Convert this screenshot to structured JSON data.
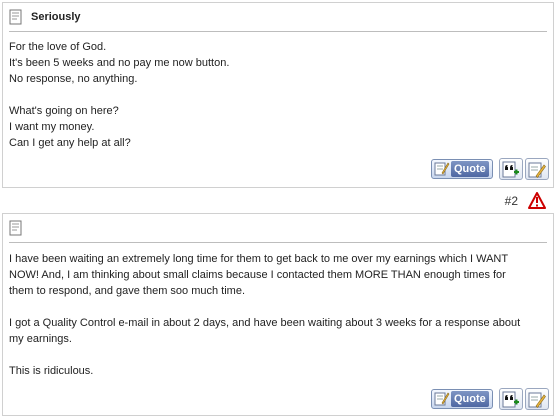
{
  "posts": [
    {
      "title": "Seriously",
      "paragraphs": [
        [
          "For the love of God.",
          "It's been 5 weeks and no pay me now button.",
          "No response, no anything."
        ],
        [
          "What's going on here?",
          "I want my money.",
          "Can I get any help at all?"
        ]
      ],
      "actions": {
        "quote_label": "Quote"
      }
    },
    {
      "number": "#2",
      "title": "",
      "paragraphs": [
        [
          "I have been waiting an extremely long time for them to get back to me over my earnings which I WANT",
          "NOW! And, I am thinking about small claims because I contacted them MORE THAN enough times for",
          "them to respond, and gave them soo much time."
        ],
        [
          "I got a Quality Control e-mail in about 2 days, and have been waiting about 3 weeks for a response about",
          "my earnings."
        ],
        [
          "This is ridiculous."
        ]
      ],
      "actions": {
        "quote_label": "Quote"
      }
    }
  ],
  "icons": {
    "post": "document-icon",
    "quote": "quote-icon",
    "multiquote": "multi-quote-icon",
    "edit": "edit-icon",
    "report": "report-warning-icon"
  },
  "colors": {
    "quote_label_bg": "#4f68a3",
    "report_red": "#cc0000",
    "divider": "#bdbdbd"
  }
}
